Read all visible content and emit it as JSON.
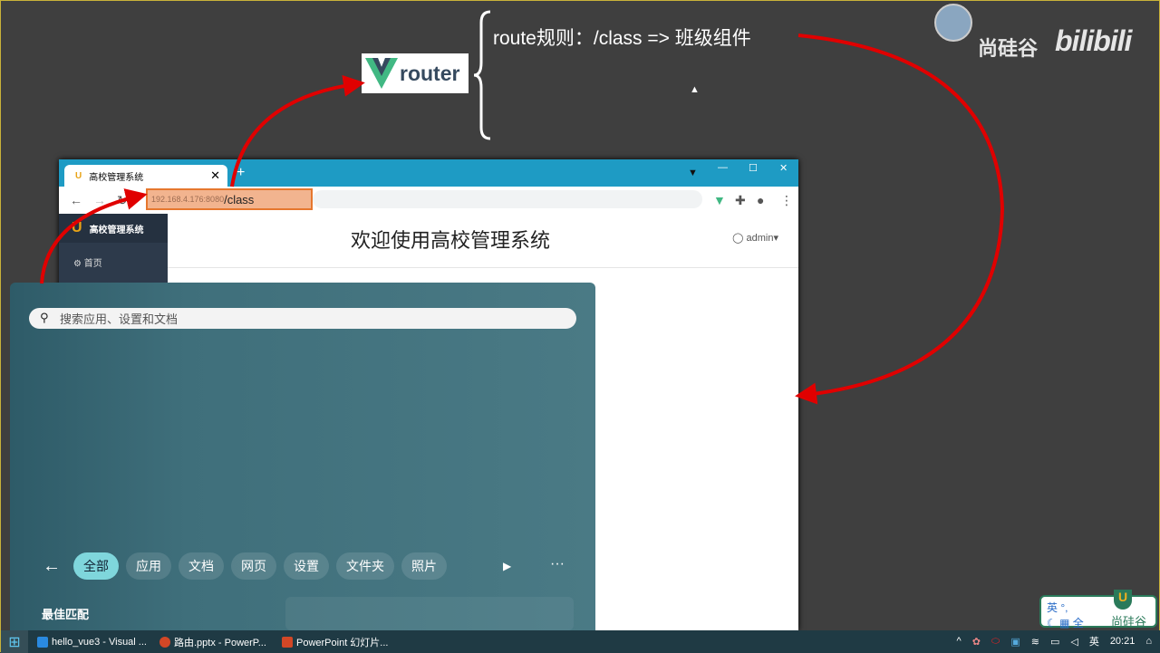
{
  "slide": {
    "route_rule": "route规则：/class =>  班级组件",
    "router_logo_text": "router",
    "brand": "尚硅谷",
    "bili": "bilibili"
  },
  "browser": {
    "tab_title": "高校管理系统",
    "url_host": "192.168.4.176:8080",
    "url_path": "/class"
  },
  "app": {
    "sidebar_title": "高校管理系统",
    "sidebar_home": "首页",
    "welcome": "欢迎使用高校管理系统",
    "user": "admin"
  },
  "start_menu": {
    "search_placeholder": "搜索应用、设置和文档",
    "filters": [
      "全部",
      "应用",
      "文档",
      "网页",
      "设置",
      "文件夹",
      "照片"
    ],
    "best_match": "最佳匹配"
  },
  "taskbar": {
    "items": [
      "hello_vue3 - Visual ...",
      "路由.pptx - PowerP...",
      "PowerPoint 幻灯片..."
    ],
    "lang": "英",
    "time": "20:21"
  },
  "ime": {
    "line1": "英 °, ",
    "line2": "全",
    "brand": "尚硅谷"
  },
  "colors": {
    "arrow": "#e00000",
    "url_highlight": "#f2b48f",
    "tabbar": "#1e9bc4"
  }
}
